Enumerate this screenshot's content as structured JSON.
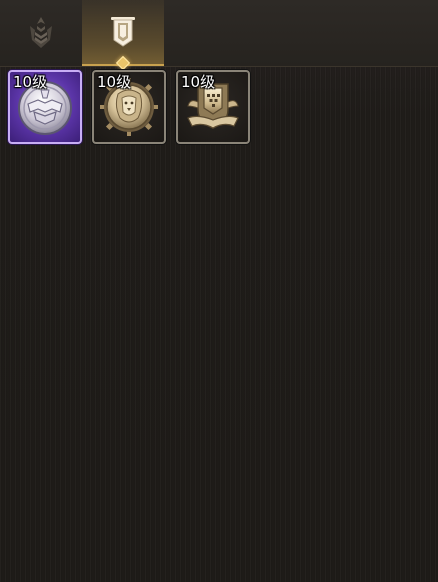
{
  "tabs": [
    {
      "icon": "rank-chevron-icon",
      "selected": false
    },
    {
      "icon": "banner-icon",
      "selected": true
    }
  ],
  "badges": [
    {
      "icon": "silver-armor-emblem-icon",
      "rarity": "epic",
      "level_label": "10级"
    },
    {
      "icon": "lion-head-medallion-icon",
      "rarity": "common",
      "level_label": "10级"
    },
    {
      "icon": "knight-helmet-shield-icon",
      "rarity": "common",
      "level_label": "10级"
    }
  ],
  "colors": {
    "accent_gold": "#c9a24f",
    "epic_purple": "#5a34a6",
    "background": "#1f1c18"
  }
}
